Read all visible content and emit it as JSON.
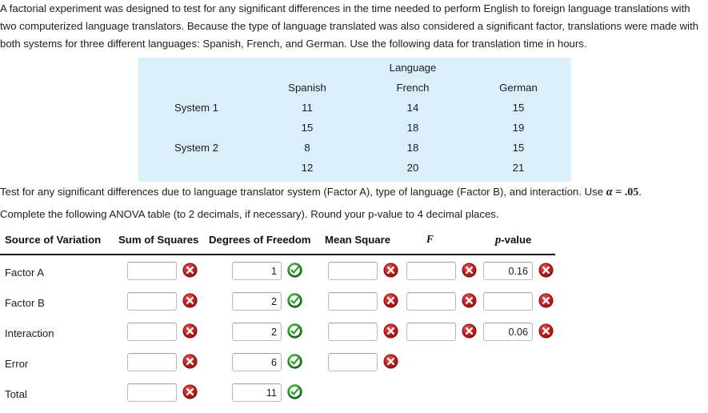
{
  "problem": {
    "statement": "A factorial experiment was designed to test for any significant differences in the time needed to perform English to foreign language translations with two computerized language translators. Because the type of language translated was also considered a significant factor, translations were made with both systems for three different languages: Spanish, French, and German. Use the following data for translation time in hours."
  },
  "data_table": {
    "group_title": "Language",
    "column_headers": [
      "Spanish",
      "French",
      "German"
    ],
    "rows": [
      {
        "label": "System 1",
        "values": [
          "11",
          "14",
          "15"
        ]
      },
      {
        "label": "",
        "values": [
          "15",
          "18",
          "19"
        ]
      },
      {
        "label": "System 2",
        "values": [
          "8",
          "18",
          "15"
        ]
      },
      {
        "label": "",
        "values": [
          "12",
          "20",
          "21"
        ]
      }
    ],
    "background_color": "#daeefb",
    "label_color": "#54b8ea"
  },
  "instructions": {
    "line1_part1": "Test for any significant differences due to language translator system (Factor A), type of language (Factor B), and interaction. Use ",
    "line1_alpha": "α",
    "line1_equals": " = ",
    "line1_value": ".05",
    "line1_period": ".",
    "line2": "Complete the following ANOVA table (to 2 decimals, if necessary). Round your p-value to 4 decimal places."
  },
  "anova": {
    "headers": {
      "source": "Source of Variation",
      "ss": "Sum of Squares",
      "df": "Degrees of Freedom",
      "ms": "Mean Square",
      "f": "F",
      "p_italic": "p",
      "p_rest": "-value"
    },
    "rows": [
      {
        "label": "Factor A",
        "cells": [
          {
            "value": "",
            "status": "incorrect"
          },
          {
            "value": "1",
            "status": "correct"
          },
          {
            "value": "",
            "status": "incorrect"
          },
          {
            "value": "",
            "status": "incorrect"
          },
          {
            "value": "0.16",
            "status": "incorrect"
          }
        ]
      },
      {
        "label": "Factor B",
        "cells": [
          {
            "value": "",
            "status": "incorrect"
          },
          {
            "value": "2",
            "status": "correct"
          },
          {
            "value": "",
            "status": "incorrect"
          },
          {
            "value": "",
            "status": "incorrect"
          },
          {
            "value": "",
            "status": "incorrect"
          }
        ]
      },
      {
        "label": "Interaction",
        "cells": [
          {
            "value": "",
            "status": "incorrect"
          },
          {
            "value": "2",
            "status": "correct"
          },
          {
            "value": "",
            "status": "incorrect"
          },
          {
            "value": "",
            "status": "incorrect"
          },
          {
            "value": "0.06",
            "status": "incorrect"
          }
        ]
      },
      {
        "label": "Error",
        "cells": [
          {
            "value": "",
            "status": "incorrect"
          },
          {
            "value": "6",
            "status": "correct"
          },
          {
            "value": "",
            "status": "incorrect"
          }
        ]
      },
      {
        "label": "Total",
        "cells": [
          {
            "value": "",
            "status": "incorrect"
          },
          {
            "value": "11",
            "status": "correct"
          }
        ]
      }
    ],
    "status_icons": {
      "incorrect": "red-x-circle-icon",
      "correct": "green-check-circle-icon"
    },
    "colors": {
      "incorrect": "#b81c1c",
      "correct": "#2f9e2f"
    }
  }
}
